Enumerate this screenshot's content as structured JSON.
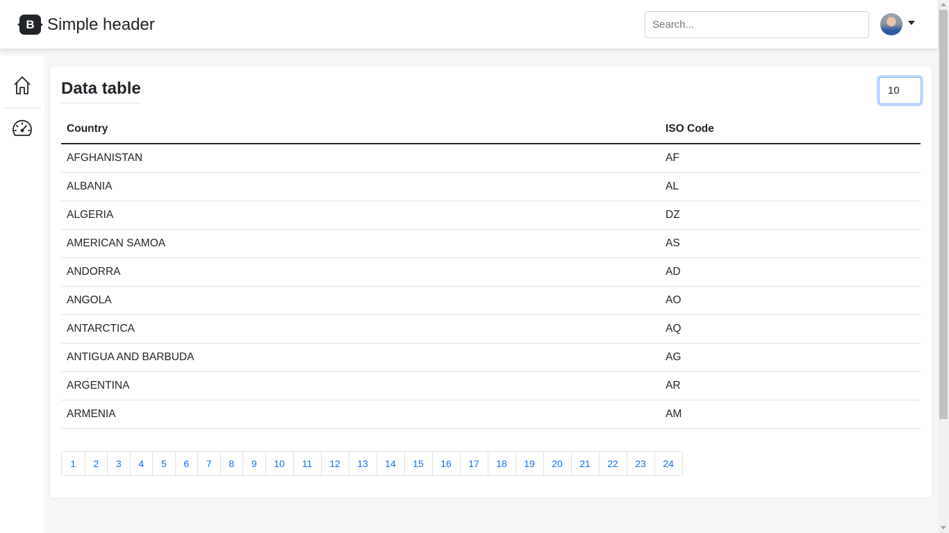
{
  "header": {
    "brand_letter": "B",
    "title": "Simple header",
    "search_placeholder": "Search..."
  },
  "sidebar": {
    "items": [
      {
        "icon": "home-icon"
      },
      {
        "icon": "speedometer-icon"
      }
    ]
  },
  "main": {
    "title": "Data table",
    "page_size": "10",
    "columns": [
      "Country",
      "ISO Code"
    ],
    "rows": [
      [
        "AFGHANISTAN",
        "AF"
      ],
      [
        "ALBANIA",
        "AL"
      ],
      [
        "ALGERIA",
        "DZ"
      ],
      [
        "AMERICAN SAMOA",
        "AS"
      ],
      [
        "ANDORRA",
        "AD"
      ],
      [
        "ANGOLA",
        "AO"
      ],
      [
        "ANTARCTICA",
        "AQ"
      ],
      [
        "ANTIGUA AND BARBUDA",
        "AG"
      ],
      [
        "ARGENTINA",
        "AR"
      ],
      [
        "ARMENIA",
        "AM"
      ]
    ],
    "pagination": [
      "1",
      "2",
      "3",
      "4",
      "5",
      "6",
      "7",
      "8",
      "9",
      "10",
      "11",
      "12",
      "13",
      "14",
      "15",
      "16",
      "17",
      "18",
      "19",
      "20",
      "21",
      "22",
      "23",
      "24"
    ]
  },
  "colors": {
    "link": "#0d6efd",
    "focus_border": "#86b7fe",
    "text": "#212529"
  }
}
